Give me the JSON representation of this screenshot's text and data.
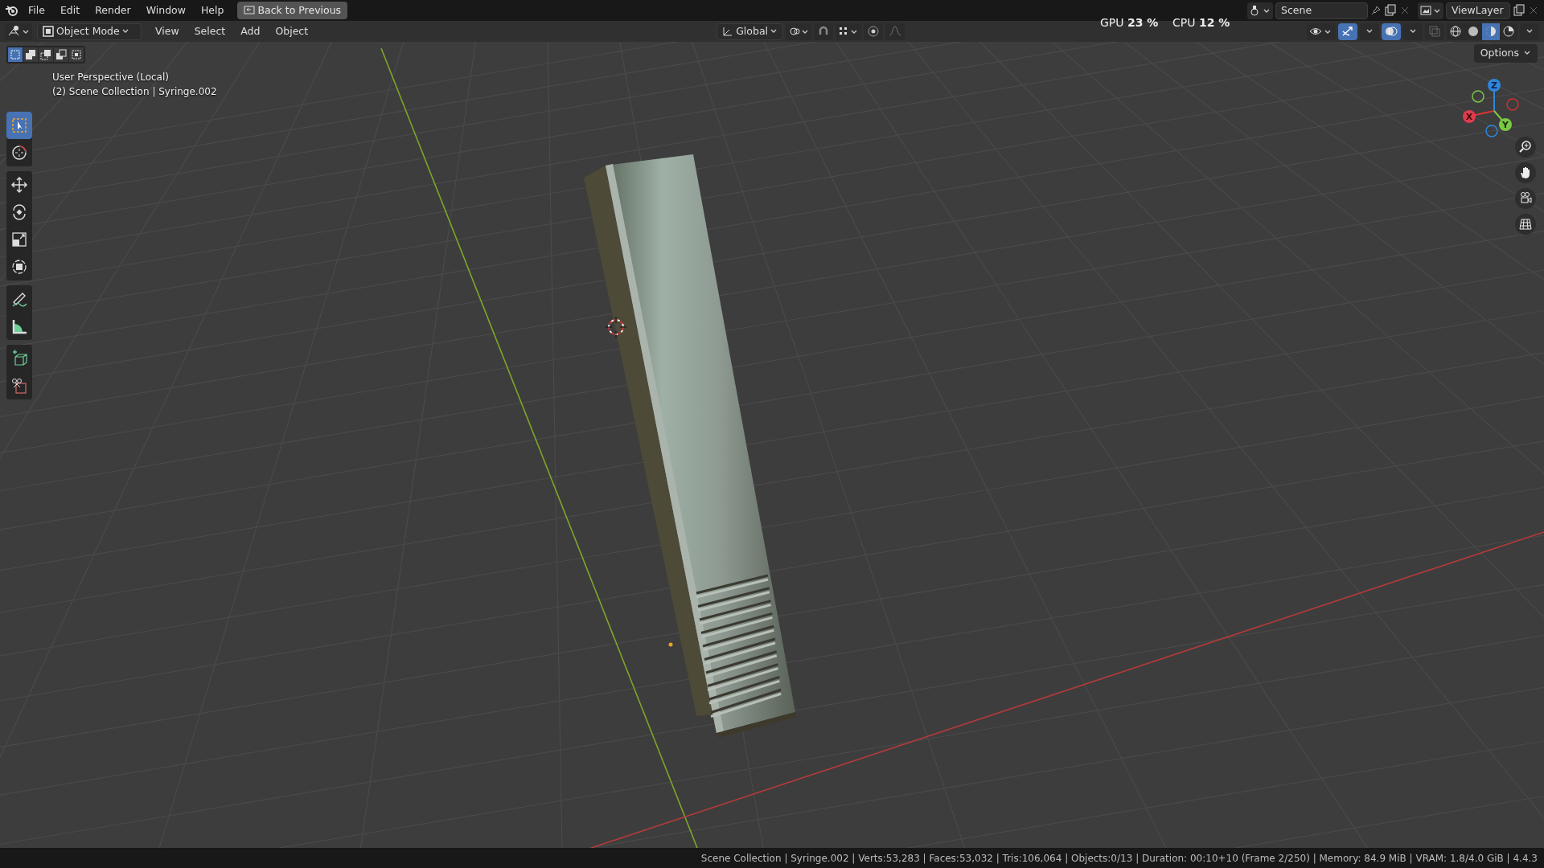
{
  "topbar": {
    "menus": [
      "File",
      "Edit",
      "Render",
      "Window",
      "Help"
    ],
    "back_button": "Back to Previous",
    "scene": "Scene",
    "view_layer": "ViewLayer"
  },
  "stats": [
    {
      "label": "GPU",
      "value": "23 %"
    },
    {
      "label": "CPU",
      "value": "12 %"
    }
  ],
  "header": {
    "mode": "Object Mode",
    "menus": [
      "View",
      "Select",
      "Add",
      "Object"
    ],
    "orientation": "Global",
    "shading": [
      {
        "kind": "wireframe",
        "selected": false
      },
      {
        "kind": "solid",
        "selected": false
      },
      {
        "kind": "material",
        "selected": true
      },
      {
        "kind": "rendered",
        "selected": false
      }
    ]
  },
  "select_modes": [
    {
      "kind": "set",
      "selected": true
    },
    {
      "kind": "extend",
      "selected": false
    },
    {
      "kind": "subtract",
      "selected": false
    },
    {
      "kind": "invert",
      "selected": false
    },
    {
      "kind": "intersect",
      "selected": false
    }
  ],
  "toolbar": [
    [
      {
        "kind": "select",
        "selected": true
      },
      {
        "kind": "cursor",
        "selected": false
      }
    ],
    [
      {
        "kind": "move",
        "selected": false
      },
      {
        "kind": "rotate",
        "selected": false
      },
      {
        "kind": "scale",
        "selected": false
      },
      {
        "kind": "transform",
        "selected": false
      }
    ],
    [
      {
        "kind": "annotate",
        "selected": false
      },
      {
        "kind": "measure",
        "selected": false
      }
    ],
    [
      {
        "kind": "add-cube",
        "selected": false
      },
      {
        "kind": "cut",
        "selected": false
      }
    ]
  ],
  "viewport_info": [
    "User Perspective (Local)",
    "(2) Scene Collection | Syringe.002"
  ],
  "options_button": "Options",
  "gizmo": {
    "x": "X",
    "y": "Y",
    "z": "Z"
  },
  "status_bar": "Scene Collection | Syringe.002 | Verts:53,283 | Faces:53,032 | Tris:106,064 | Objects:0/13 | Duration: 00:10+10 (Frame 2/250) | Memory: 84.9 MiB | VRAM: 1.8/4.0 GiB | 4.4.3"
}
